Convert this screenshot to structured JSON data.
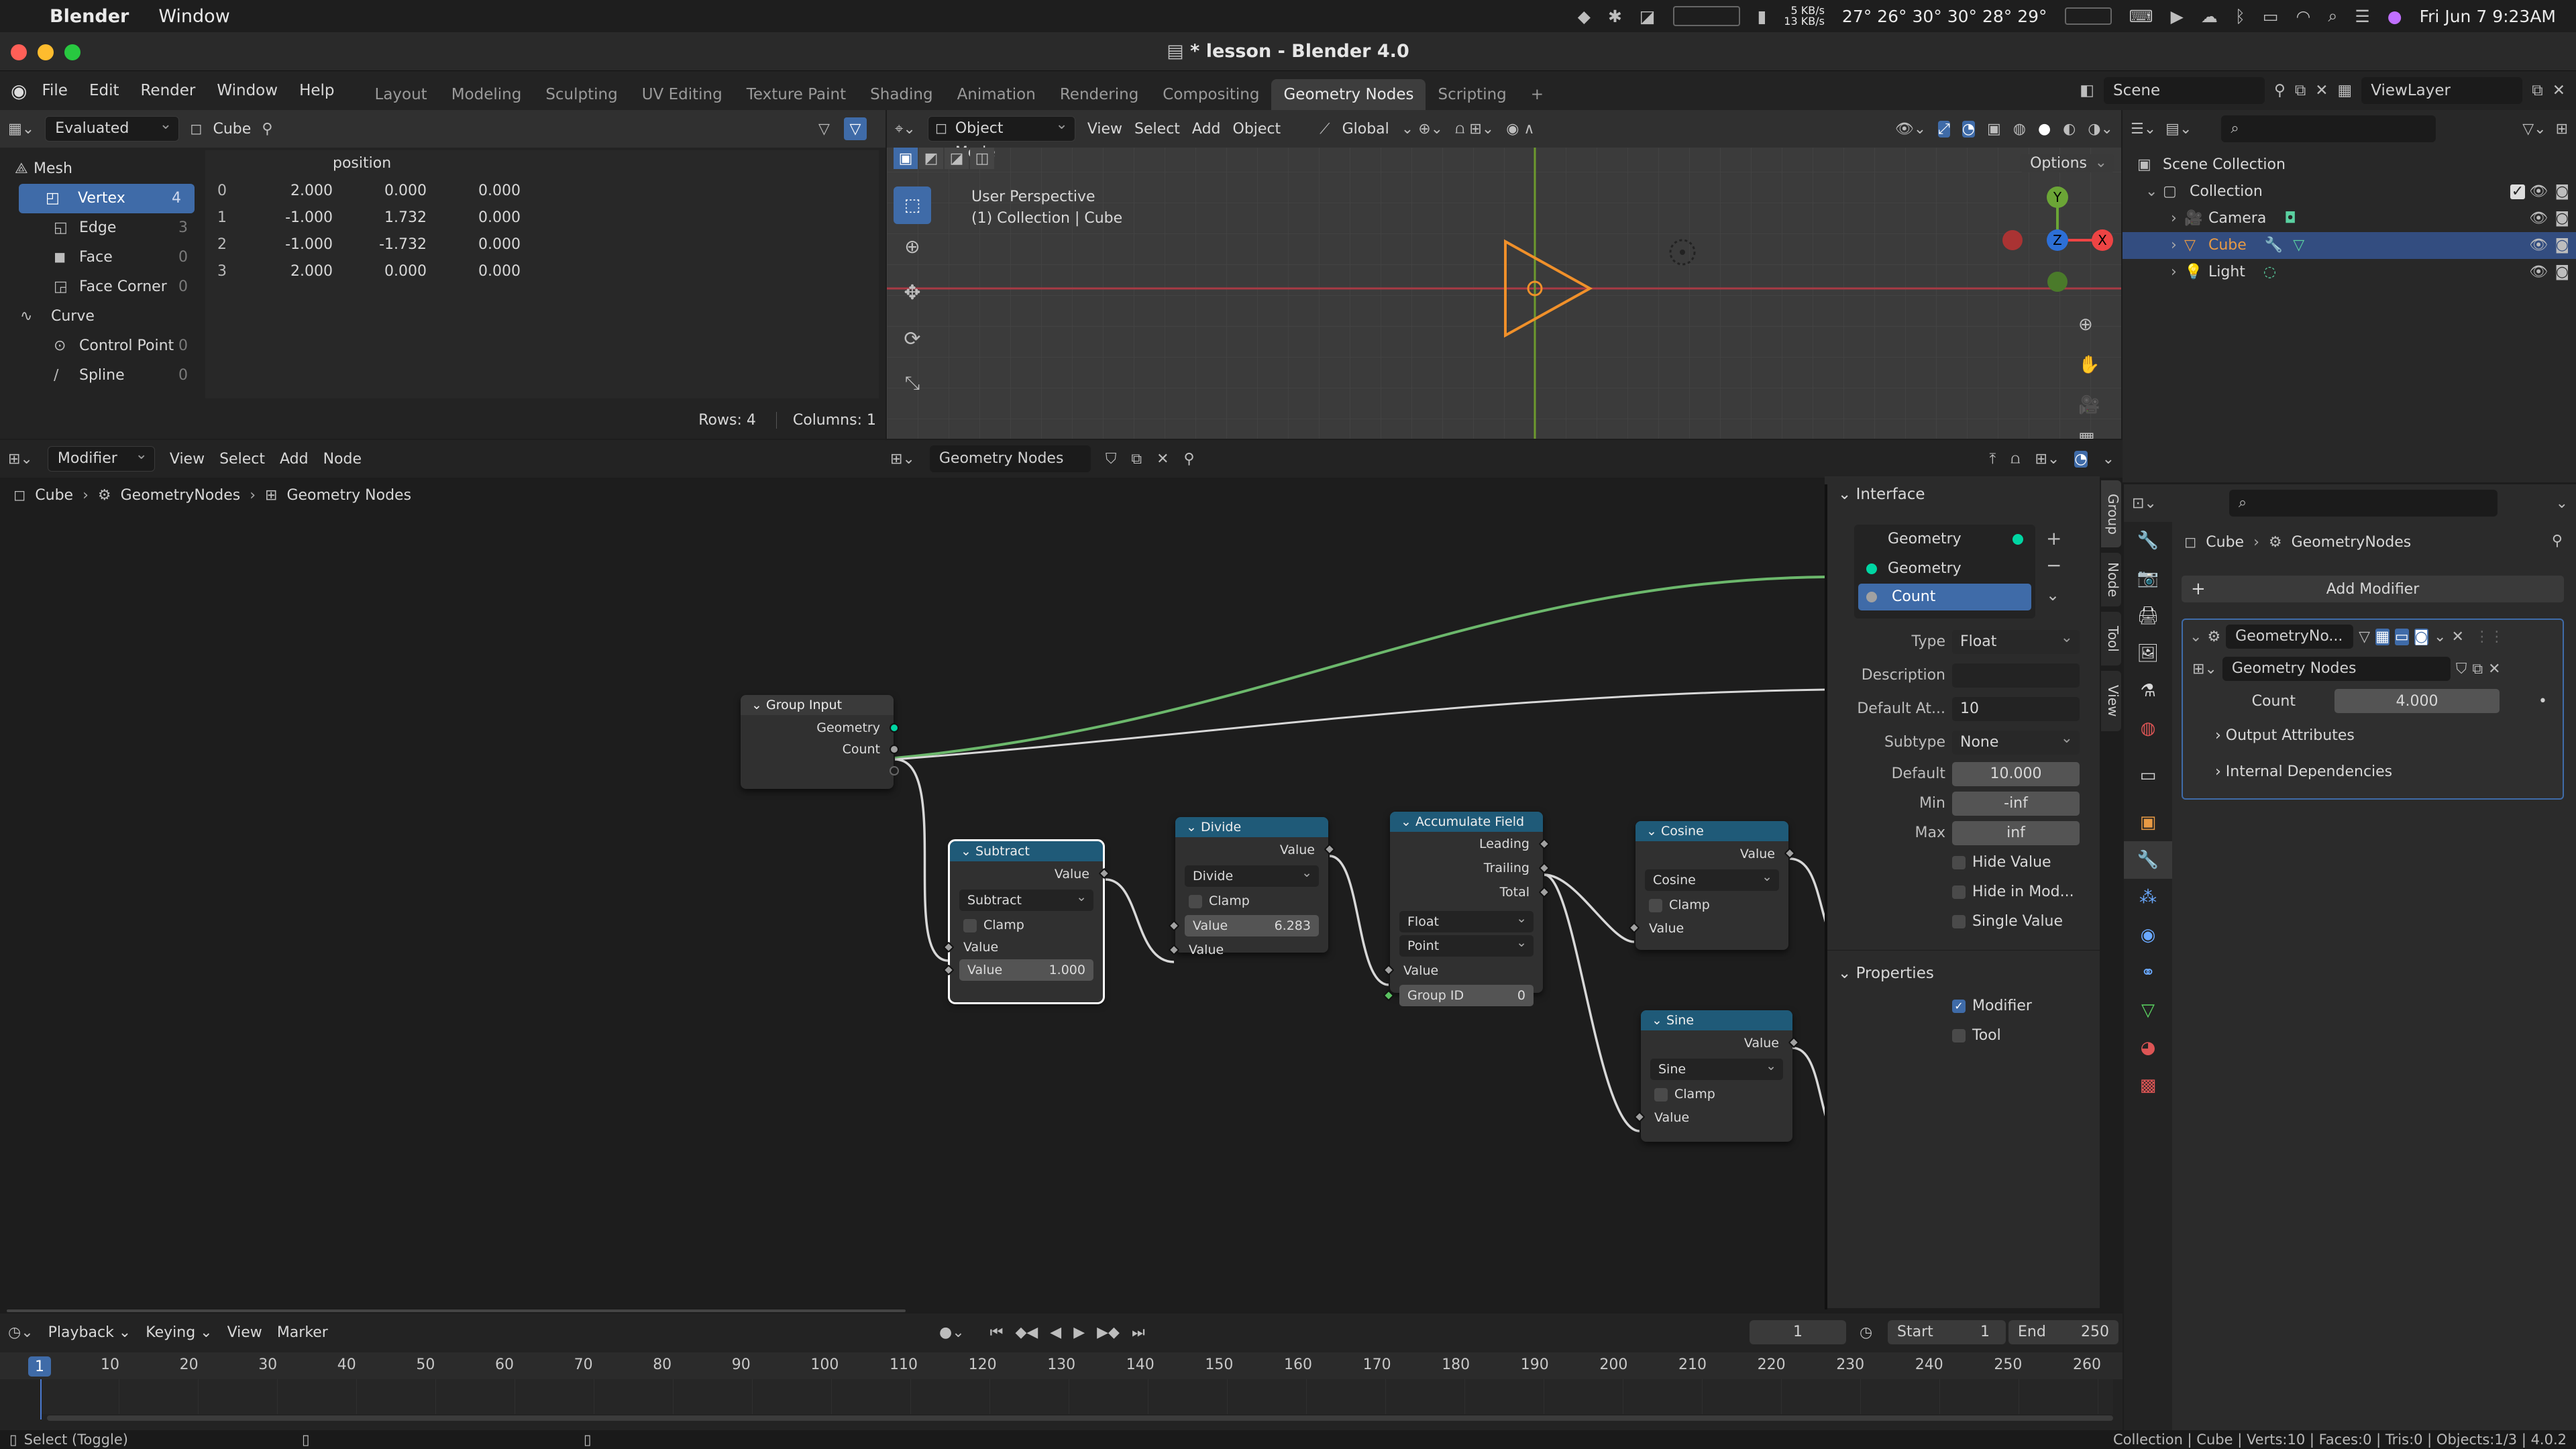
{
  "macos": {
    "app_name": "Blender",
    "menu_items": [
      "Window"
    ],
    "net_up": "5 KB/s",
    "net_down": "13 KB/s",
    "temps": "27° 26° 30° 30° 28° 29°",
    "datetime": "Fri Jun 7  9:23AM"
  },
  "window": {
    "title": "* lesson - Blender 4.0"
  },
  "topbar": {
    "menus": [
      "File",
      "Edit",
      "Render",
      "Window",
      "Help"
    ],
    "workspaces": [
      "Layout",
      "Modeling",
      "Sculpting",
      "UV Editing",
      "Texture Paint",
      "Shading",
      "Animation",
      "Rendering",
      "Compositing",
      "Geometry Nodes",
      "Scripting"
    ],
    "active_workspace": "Geometry Nodes",
    "add_tab": "+",
    "scene": "Scene",
    "view_layer": "ViewLayer"
  },
  "spreadsheet": {
    "mode": "Evaluated",
    "object": "Cube",
    "groups": [
      {
        "label": "Mesh",
        "items": [
          {
            "label": "Vertex",
            "count": "4",
            "selected": true
          },
          {
            "label": "Edge",
            "count": "3"
          },
          {
            "label": "Face",
            "count": "0"
          },
          {
            "label": "Face Corner",
            "count": "0"
          }
        ]
      },
      {
        "label": "Curve",
        "items": [
          {
            "label": "Control Point",
            "count": "0"
          },
          {
            "label": "Spline",
            "count": "0"
          }
        ]
      }
    ],
    "column_header": "position",
    "rows": [
      [
        "0",
        "2.000",
        "0.000",
        "0.000"
      ],
      [
        "1",
        "-1.000",
        "1.732",
        "0.000"
      ],
      [
        "2",
        "-1.000",
        "-1.732",
        "0.000"
      ],
      [
        "3",
        "2.000",
        "0.000",
        "0.000"
      ]
    ],
    "footer_rows": "Rows: 4",
    "footer_cols": "Columns: 1"
  },
  "viewport": {
    "mode": "Object Mode",
    "menus": [
      "View",
      "Select",
      "Add",
      "Object"
    ],
    "transform": "Global",
    "options": "Options",
    "perspective": "User Perspective",
    "collection": "(1) Collection | Cube",
    "gizmo": {
      "x": "X",
      "y": "Y",
      "z": "Z"
    }
  },
  "outliner": {
    "root": "Scene Collection",
    "collection": "Collection",
    "items": [
      {
        "label": "Camera",
        "selected": false
      },
      {
        "label": "Cube",
        "selected": true
      },
      {
        "label": "Light",
        "selected": false
      }
    ]
  },
  "node_editor": {
    "editor_mode": "Modifier",
    "menus": [
      "View",
      "Select",
      "Add",
      "Node"
    ],
    "tree_name": "Geometry Nodes",
    "breadcrumb": [
      "Cube",
      "GeometryNodes",
      "Geometry Nodes"
    ],
    "nodes": {
      "group_input": {
        "title": "Group Input",
        "outputs": [
          "Geometry",
          "Count"
        ]
      },
      "subtract": {
        "title": "Subtract",
        "output": "Value",
        "op": "Subtract",
        "clamp": "Clamp",
        "input1": "Value",
        "input2_label": "Value",
        "input2_value": "1.000"
      },
      "divide": {
        "title": "Divide",
        "output": "Value",
        "op": "Divide",
        "clamp": "Clamp",
        "input1_label": "Value",
        "input1_value": "6.283",
        "input2": "Value"
      },
      "accumulate": {
        "title": "Accumulate Field",
        "outputs": [
          "Leading",
          "Trailing",
          "Total"
        ],
        "type": "Float",
        "domain": "Point",
        "input_value": "Value",
        "group_id_label": "Group ID",
        "group_id_value": "0"
      },
      "cosine": {
        "title": "Cosine",
        "output": "Value",
        "op": "Cosine",
        "clamp": "Clamp",
        "input": "Value"
      },
      "sine": {
        "title": "Sine",
        "output": "Value",
        "op": "Sine",
        "clamp": "Clamp",
        "input": "Value"
      }
    }
  },
  "npanel": {
    "interface_title": "Interface",
    "sockets": [
      "Geometry",
      "Geometry",
      "Count"
    ],
    "type_label": "Type",
    "type_value": "Float",
    "description_label": "Description",
    "default_attr_label": "Default At...",
    "default_attr_value": "10",
    "subtype_label": "Subtype",
    "subtype_value": "None",
    "default_label": "Default",
    "default_value": "10.000",
    "min_label": "Min",
    "min_value": "-inf",
    "max_label": "Max",
    "max_value": "inf",
    "hide_value": "Hide Value",
    "hide_in_mod": "Hide in Mod...",
    "single_value": "Single Value",
    "properties_title": "Properties",
    "modifier": "Modifier",
    "tool": "Tool",
    "tabs": [
      "Group",
      "Node",
      "Tool",
      "View"
    ]
  },
  "properties": {
    "breadcrumb_obj": "Cube",
    "breadcrumb_mod": "GeometryNodes",
    "add_modifier": "Add Modifier",
    "modifier_name": "GeometryNo...",
    "node_group": "Geometry Nodes",
    "count_label": "Count",
    "count_value": "4.000",
    "output_attributes": "Output Attributes",
    "internal_dependencies": "Internal Dependencies"
  },
  "timeline": {
    "menus": [
      "Playback",
      "Keying",
      "View",
      "Marker"
    ],
    "current_frame": "1",
    "start_label": "Start",
    "start_value": "1",
    "end_label": "End",
    "end_value": "250",
    "ticks": [
      "10",
      "20",
      "30",
      "40",
      "50",
      "60",
      "70",
      "80",
      "90",
      "100",
      "110",
      "120",
      "130",
      "140",
      "150",
      "160",
      "170",
      "180",
      "190",
      "200",
      "210",
      "220",
      "230",
      "240",
      "250",
      "260"
    ]
  },
  "status": {
    "left": "Select (Toggle)",
    "right": "Collection | Cube | Verts:10 | Faces:0 | Tris:0 | Objects:1/3 | 4.0.2"
  }
}
